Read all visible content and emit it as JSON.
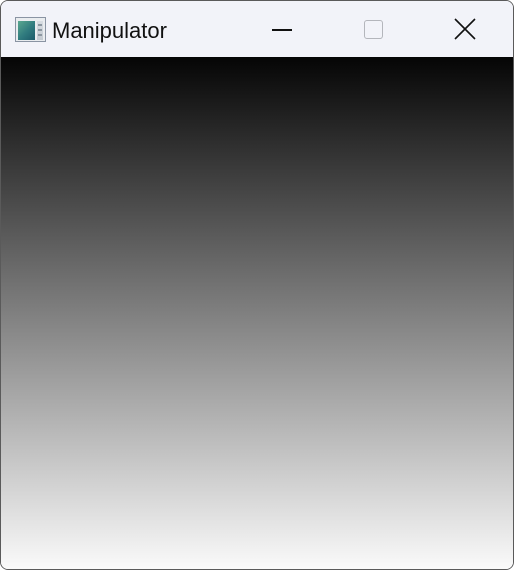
{
  "window": {
    "title": "Manipulator",
    "app_icon": "app-window-icon"
  },
  "titlebar": {
    "buttons": {
      "minimize": {
        "icon": "minimize-icon"
      },
      "maximize": {
        "icon": "maximize-icon",
        "state": "disabled"
      },
      "close": {
        "icon": "close-icon"
      }
    }
  },
  "canvas": {
    "gradient": {
      "direction": "vertical",
      "top_color": "#050505",
      "bottom_color": "#fafafa"
    }
  }
}
